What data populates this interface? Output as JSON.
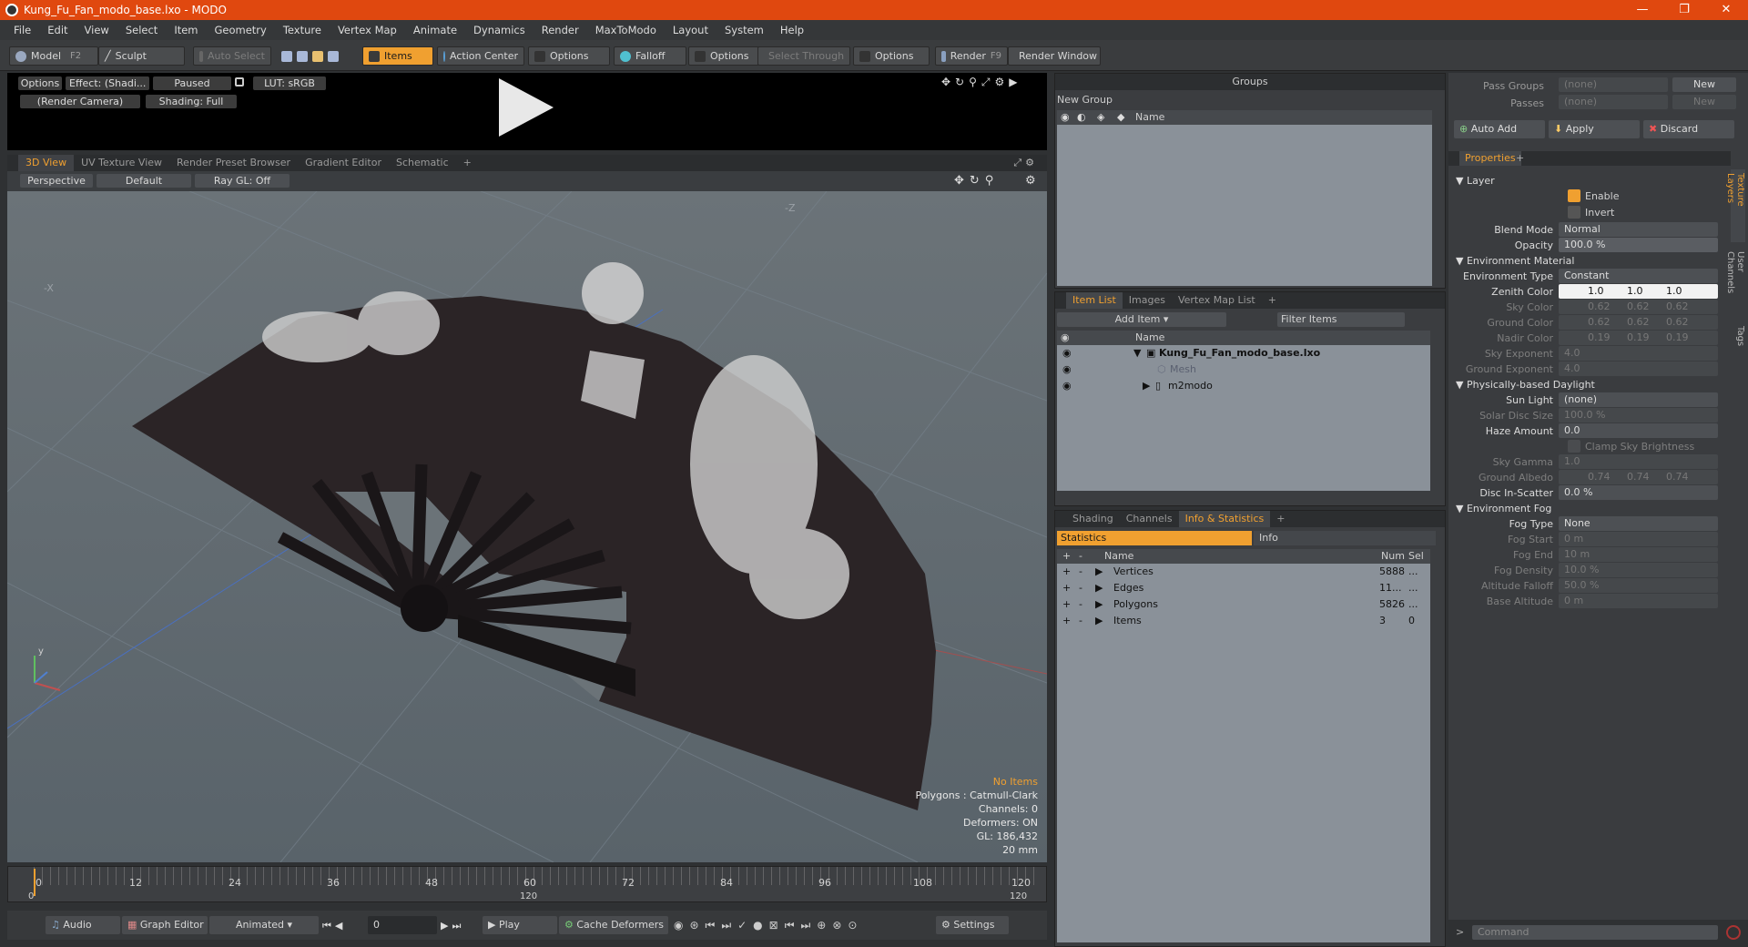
{
  "window": {
    "title": "Kung_Fu_Fan_modo_base.lxo - MODO",
    "minimize": "—",
    "restore": "❐",
    "close": "✕"
  },
  "menu": [
    "File",
    "Edit",
    "View",
    "Select",
    "Item",
    "Geometry",
    "Texture",
    "Vertex Map",
    "Animate",
    "Dynamics",
    "Render",
    "MaxToModo",
    "Layout",
    "System",
    "Help"
  ],
  "toolbar": {
    "model": "Model",
    "model_key": "F2",
    "sculpt": "Sculpt",
    "auto_select": "Auto Select",
    "items": "Items",
    "action_center": "Action Center",
    "options1": "Options",
    "falloff": "Falloff",
    "options2": "Options",
    "select_through": "Select Through",
    "options3": "Options",
    "render": "Render",
    "render_key": "F9",
    "render_window": "Render Window"
  },
  "preview": {
    "options": "Options",
    "effect": "Effect: (Shadi...",
    "paused": "Paused",
    "lut": "LUT: sRGB",
    "camera": "(Render Camera)",
    "shading": "Shading: Full"
  },
  "view_tabs": [
    "3D View",
    "UV Texture View",
    "Render Preset Browser",
    "Gradient Editor",
    "Schematic",
    "+"
  ],
  "view_bar": {
    "perspective": "Perspective",
    "default": "Default",
    "raygl": "Ray GL: Off"
  },
  "viewport": {
    "axis_z": "-Z",
    "axis_x": "-X",
    "no_items": "No Items",
    "polygons": "Polygons : Catmull-Clark",
    "channels": "Channels: 0",
    "deformers": "Deformers: ON",
    "gl": "GL: 186,432",
    "zoom": "20 mm"
  },
  "timeline": {
    "ticks": [
      "0",
      "12",
      "24",
      "36",
      "48",
      "60",
      "72",
      "84",
      "96",
      "108",
      "120"
    ],
    "range_start": "0",
    "range_mid": "120",
    "range_end": "120"
  },
  "bottom": {
    "audio": "Audio",
    "graph_editor": "Graph Editor",
    "animated": "Animated",
    "frame": "0",
    "play": "Play",
    "cache": "Cache Deformers",
    "settings": "Settings"
  },
  "groups": {
    "title": "Groups",
    "new_group": "New Group",
    "col_name": "Name"
  },
  "itemlist": {
    "tabs": [
      "Item List",
      "Images",
      "Vertex Map List",
      "+"
    ],
    "add_item": "Add Item",
    "filter": "Filter Items",
    "col_name": "Name",
    "rows": [
      {
        "name": "Kung_Fu_Fan_modo_base.lxo"
      },
      {
        "name": "Mesh"
      },
      {
        "name": "m2modo"
      }
    ]
  },
  "stats": {
    "tabs": [
      "Shading",
      "Channels",
      "Info & Statistics",
      "+"
    ],
    "statistics": "Statistics",
    "info": "Info",
    "col_name": "Name",
    "col_num": "Num",
    "col_sel": "Sel",
    "rows": [
      {
        "name": "Vertices",
        "num": "5888",
        "sel": "..."
      },
      {
        "name": "Edges",
        "num": "11...",
        "sel": "..."
      },
      {
        "name": "Polygons",
        "num": "5826",
        "sel": "..."
      },
      {
        "name": "Items",
        "num": "3",
        "sel": "0"
      }
    ]
  },
  "passes": {
    "pass_groups": "Pass Groups",
    "passes": "Passes",
    "none": "(none)",
    "new": "New",
    "auto_add": "Auto Add",
    "apply": "Apply",
    "discard": "Discard"
  },
  "properties": {
    "tab": "Properties",
    "layer": "Layer",
    "enable": "Enable",
    "invert": "Invert",
    "blend_mode": "Blend Mode",
    "blend_val": "Normal",
    "opacity": "Opacity",
    "opacity_val": "100.0 %",
    "env_material": "Environment Material",
    "env_type": "Environment Type",
    "env_type_val": "Constant",
    "zenith": "Zenith Color",
    "zenith_vals": [
      "1.0",
      "1.0",
      "1.0"
    ],
    "sky": "Sky Color",
    "sky_vals": [
      "0.62",
      "0.62",
      "0.62"
    ],
    "ground": "Ground Color",
    "ground_vals": [
      "0.62",
      "0.62",
      "0.62"
    ],
    "nadir": "Nadir Color",
    "nadir_vals": [
      "0.19",
      "0.19",
      "0.19"
    ],
    "sky_exp": "Sky Exponent",
    "sky_exp_val": "4.0",
    "ground_exp": "Ground Exponent",
    "ground_exp_val": "4.0",
    "daylight": "Physically-based Daylight",
    "sun_light": "Sun Light",
    "sun_val": "(none)",
    "solar": "Solar Disc Size",
    "solar_val": "100.0 %",
    "haze": "Haze Amount",
    "haze_val": "0.0",
    "clamp": "Clamp Sky Brightness",
    "sky_gamma": "Sky Gamma",
    "sky_gamma_val": "1.0",
    "albedo": "Ground Albedo",
    "albedo_vals": [
      "0.74",
      "0.74",
      "0.74"
    ],
    "disc": "Disc In-Scatter",
    "disc_val": "0.0 %",
    "fog": "Environment Fog",
    "fog_type": "Fog Type",
    "fog_type_val": "None",
    "fog_start": "Fog Start",
    "fog_start_val": "0 m",
    "fog_end": "Fog End",
    "fog_end_val": "10 m",
    "fog_density": "Fog Density",
    "fog_density_val": "10.0 %",
    "altitude": "Altitude Falloff",
    "altitude_val": "50.0 %",
    "base_alt": "Base Altitude",
    "base_alt_val": "0 m"
  },
  "side_tabs": [
    "Texture Layers",
    "User Channels",
    "Tags"
  ],
  "command": "Command"
}
